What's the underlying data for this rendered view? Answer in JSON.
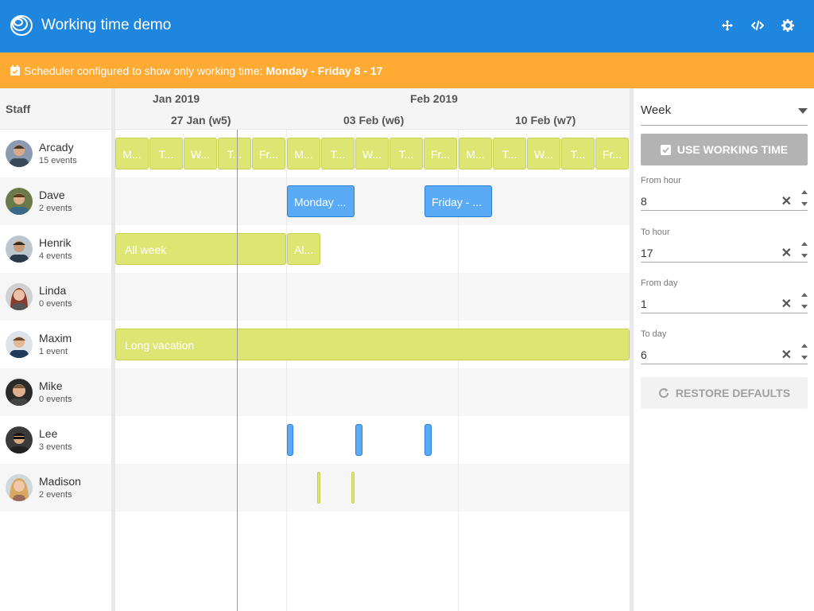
{
  "header": {
    "title": "Working time demo",
    "icons": [
      "logo-icon",
      "fullscreen-icon",
      "code-icon",
      "settings-icon"
    ]
  },
  "infobar": {
    "text": "Scheduler configured to show only working time:",
    "highlight": "Monday - Friday 8 - 17"
  },
  "staff": {
    "header": "Staff",
    "rows": [
      {
        "name": "Arcady",
        "count": "15 events"
      },
      {
        "name": "Dave",
        "count": "2 events"
      },
      {
        "name": "Henrik",
        "count": "4 events"
      },
      {
        "name": "Linda",
        "count": "0 events"
      },
      {
        "name": "Maxim",
        "count": "1 event"
      },
      {
        "name": "Mike",
        "count": "0 events"
      },
      {
        "name": "Lee",
        "count": "3 events"
      },
      {
        "name": "Madison",
        "count": "2 events"
      }
    ]
  },
  "timeline": {
    "months": [
      "Jan 2019",
      "Feb 2019"
    ],
    "weeks": [
      "27 Jan (w5)",
      "03 Feb (w6)",
      "10 Feb (w7)"
    ],
    "events": {
      "arcady": [
        "M...",
        "T...",
        "W...",
        "T...",
        "Fr...",
        "M...",
        "T...",
        "W...",
        "T...",
        "Fr...",
        "M...",
        "T...",
        "W...",
        "T...",
        "Fr..."
      ],
      "dave": [
        "Monday ...",
        "Friday - ..."
      ],
      "henrik": [
        "All week",
        "Al..."
      ],
      "maxim": [
        "Long vacation"
      ]
    }
  },
  "panel": {
    "view_select": "Week",
    "use_working_time": "USE WORKING TIME",
    "fields": [
      {
        "label": "From hour",
        "value": "8"
      },
      {
        "label": "To hour",
        "value": "17"
      },
      {
        "label": "From day",
        "value": "1"
      },
      {
        "label": "To day",
        "value": "6"
      }
    ],
    "restore_defaults": "RESTORE DEFAULTS"
  },
  "colors": {
    "header": "#1f86e0",
    "infobar": "#ffaa33",
    "event_green": "#dde672",
    "event_blue": "#5aaaf5"
  }
}
